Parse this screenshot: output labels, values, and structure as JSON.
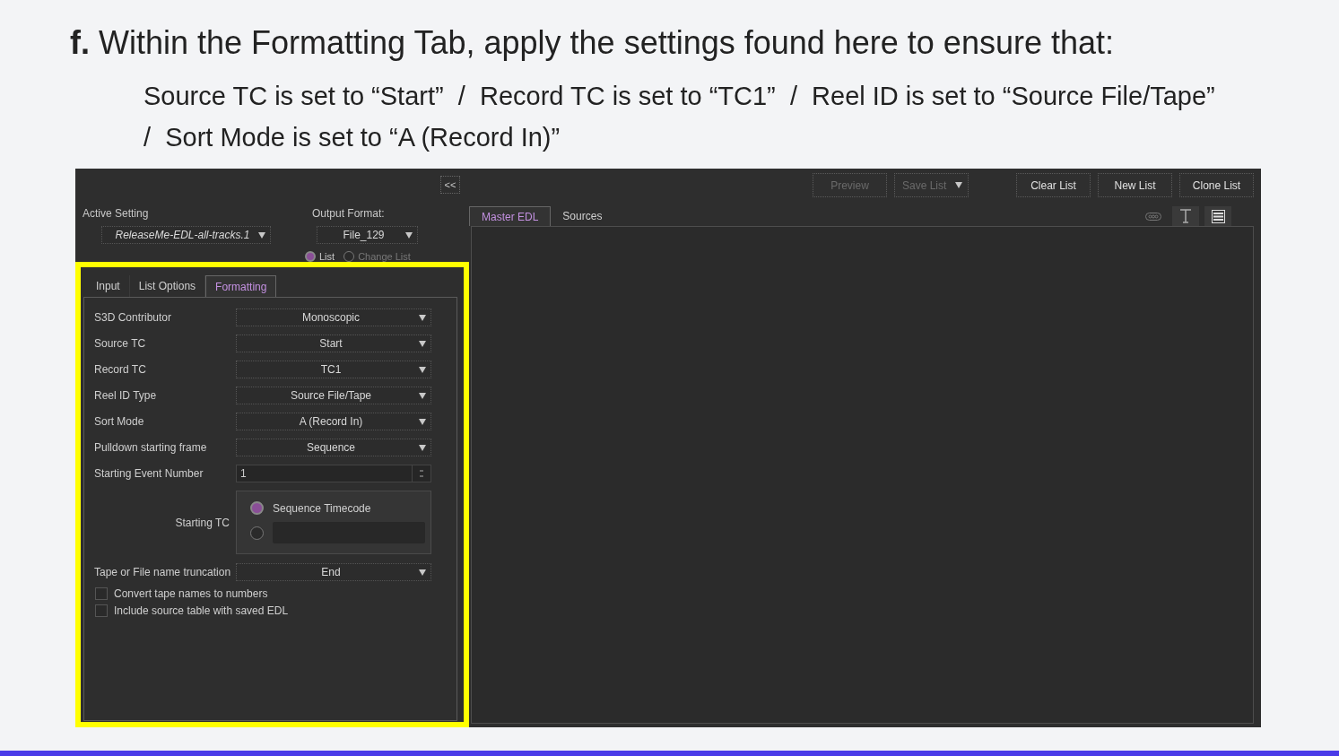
{
  "heading": "**f.** Within the Formatting Tab, apply the settings found here to ensure that:",
  "instructions": [
    "Source TC is set to “Start”  /  Record TC is set to “TC1”  /  Reel ID is set to “Source File/Tape”",
    "/  Sort Mode is set to “A (Record In)”"
  ],
  "app": {
    "collapse_button": "<<",
    "active_setting": {
      "label": "Active Setting",
      "value": "ReleaseMe-EDL-all-tracks.1"
    },
    "output_format": {
      "label": "Output Format:",
      "value": "File_129"
    },
    "list_type": [
      {
        "label": "List",
        "selected": true
      },
      {
        "label": "Change List",
        "selected": false
      }
    ],
    "settings_tabs": [
      {
        "label": "Input",
        "selected": false
      },
      {
        "label": "List Options",
        "selected": false
      },
      {
        "label": "Formatting",
        "selected": true
      }
    ],
    "fields": [
      {
        "kind": "dropdown",
        "label": "S3D Contributor",
        "value": "Monoscopic"
      },
      {
        "kind": "dropdown",
        "label": "Source TC",
        "value": "Start"
      },
      {
        "kind": "dropdown",
        "label": "Record TC",
        "value": "TC1"
      },
      {
        "kind": "dropdown",
        "label": "Reel ID Type",
        "value": "Source File/Tape"
      },
      {
        "kind": "dropdown",
        "label": "Sort Mode",
        "value": "A (Record In)"
      },
      {
        "kind": "dropdown",
        "label": "Pulldown starting frame",
        "value": "Sequence"
      },
      {
        "kind": "spinner",
        "label": "Starting Event Number",
        "value": "1"
      },
      {
        "kind": "radio-group",
        "label": "Starting TC",
        "options": [
          {
            "kind": "text",
            "label": "Sequence Timecode",
            "selected": true
          },
          {
            "kind": "input",
            "selected": false
          }
        ]
      },
      {
        "kind": "dropdown",
        "label": "Tape or File name truncation",
        "value": "End"
      },
      {
        "kind": "checkbox",
        "label": "Convert tape names to numbers",
        "checked": false
      },
      {
        "kind": "checkbox",
        "label": "Include source table with saved EDL",
        "checked": false
      }
    ],
    "toolbar": [
      {
        "label": "Preview",
        "disabled": true,
        "menu": false
      },
      {
        "label": "Save List",
        "disabled": true,
        "menu": true
      },
      {
        "label": "Clear List",
        "disabled": false,
        "menu": false
      },
      {
        "label": "New List",
        "disabled": false,
        "menu": false
      },
      {
        "label": "Clone List",
        "disabled": false,
        "menu": false
      }
    ],
    "view_tabs": [
      {
        "label": "Master EDL",
        "selected": true
      },
      {
        "label": "Sources",
        "selected": false
      }
    ]
  }
}
